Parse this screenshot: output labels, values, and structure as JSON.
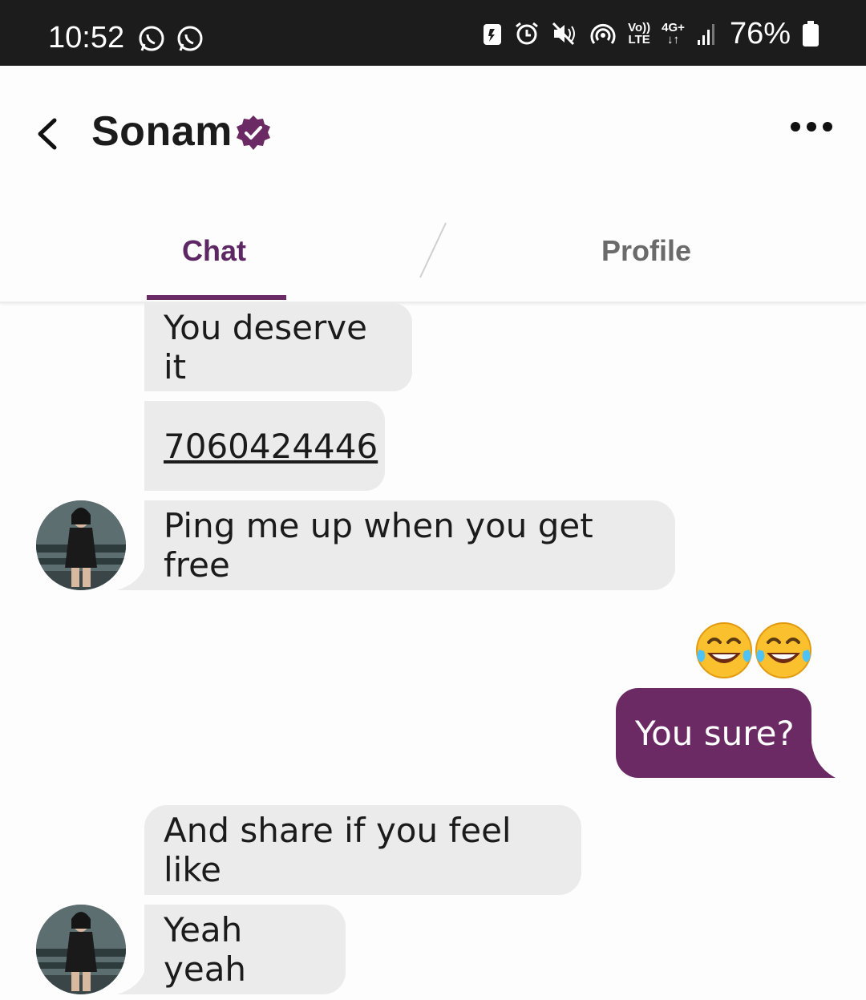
{
  "status_bar": {
    "time": "10:52",
    "battery_percent": "76%",
    "volte_label_top": "Vo))",
    "volte_label_bottom": "LTE",
    "network_label_top": "4G+",
    "network_label_bottom": "↓↑",
    "icons": [
      "whatsapp-icon",
      "whatsapp-icon",
      "battery-saver-icon",
      "alarm-icon",
      "mute-icon",
      "hotspot-icon",
      "signal-icon",
      "battery-icon"
    ]
  },
  "header": {
    "title": "Sonam",
    "verified": true,
    "accent": "#6b2a64"
  },
  "tabs": [
    {
      "label": "Chat",
      "active": true
    },
    {
      "label": "Profile",
      "active": false
    }
  ],
  "messages": [
    {
      "from": "them",
      "text": "You deserve it"
    },
    {
      "from": "them",
      "text": "7060424446"
    },
    {
      "from": "them",
      "text": "Ping me up when you get free"
    },
    {
      "from": "me",
      "emoji": "😂😂"
    },
    {
      "from": "me",
      "text": "You sure?"
    },
    {
      "from": "them",
      "text": "And share if you feel like"
    },
    {
      "from": "them",
      "text": "Yeah yeah"
    }
  ],
  "colors": {
    "incoming_bubble": "#ebebeb",
    "outgoing_bubble": "#6b2a64",
    "active_tab": "#5d2763"
  }
}
